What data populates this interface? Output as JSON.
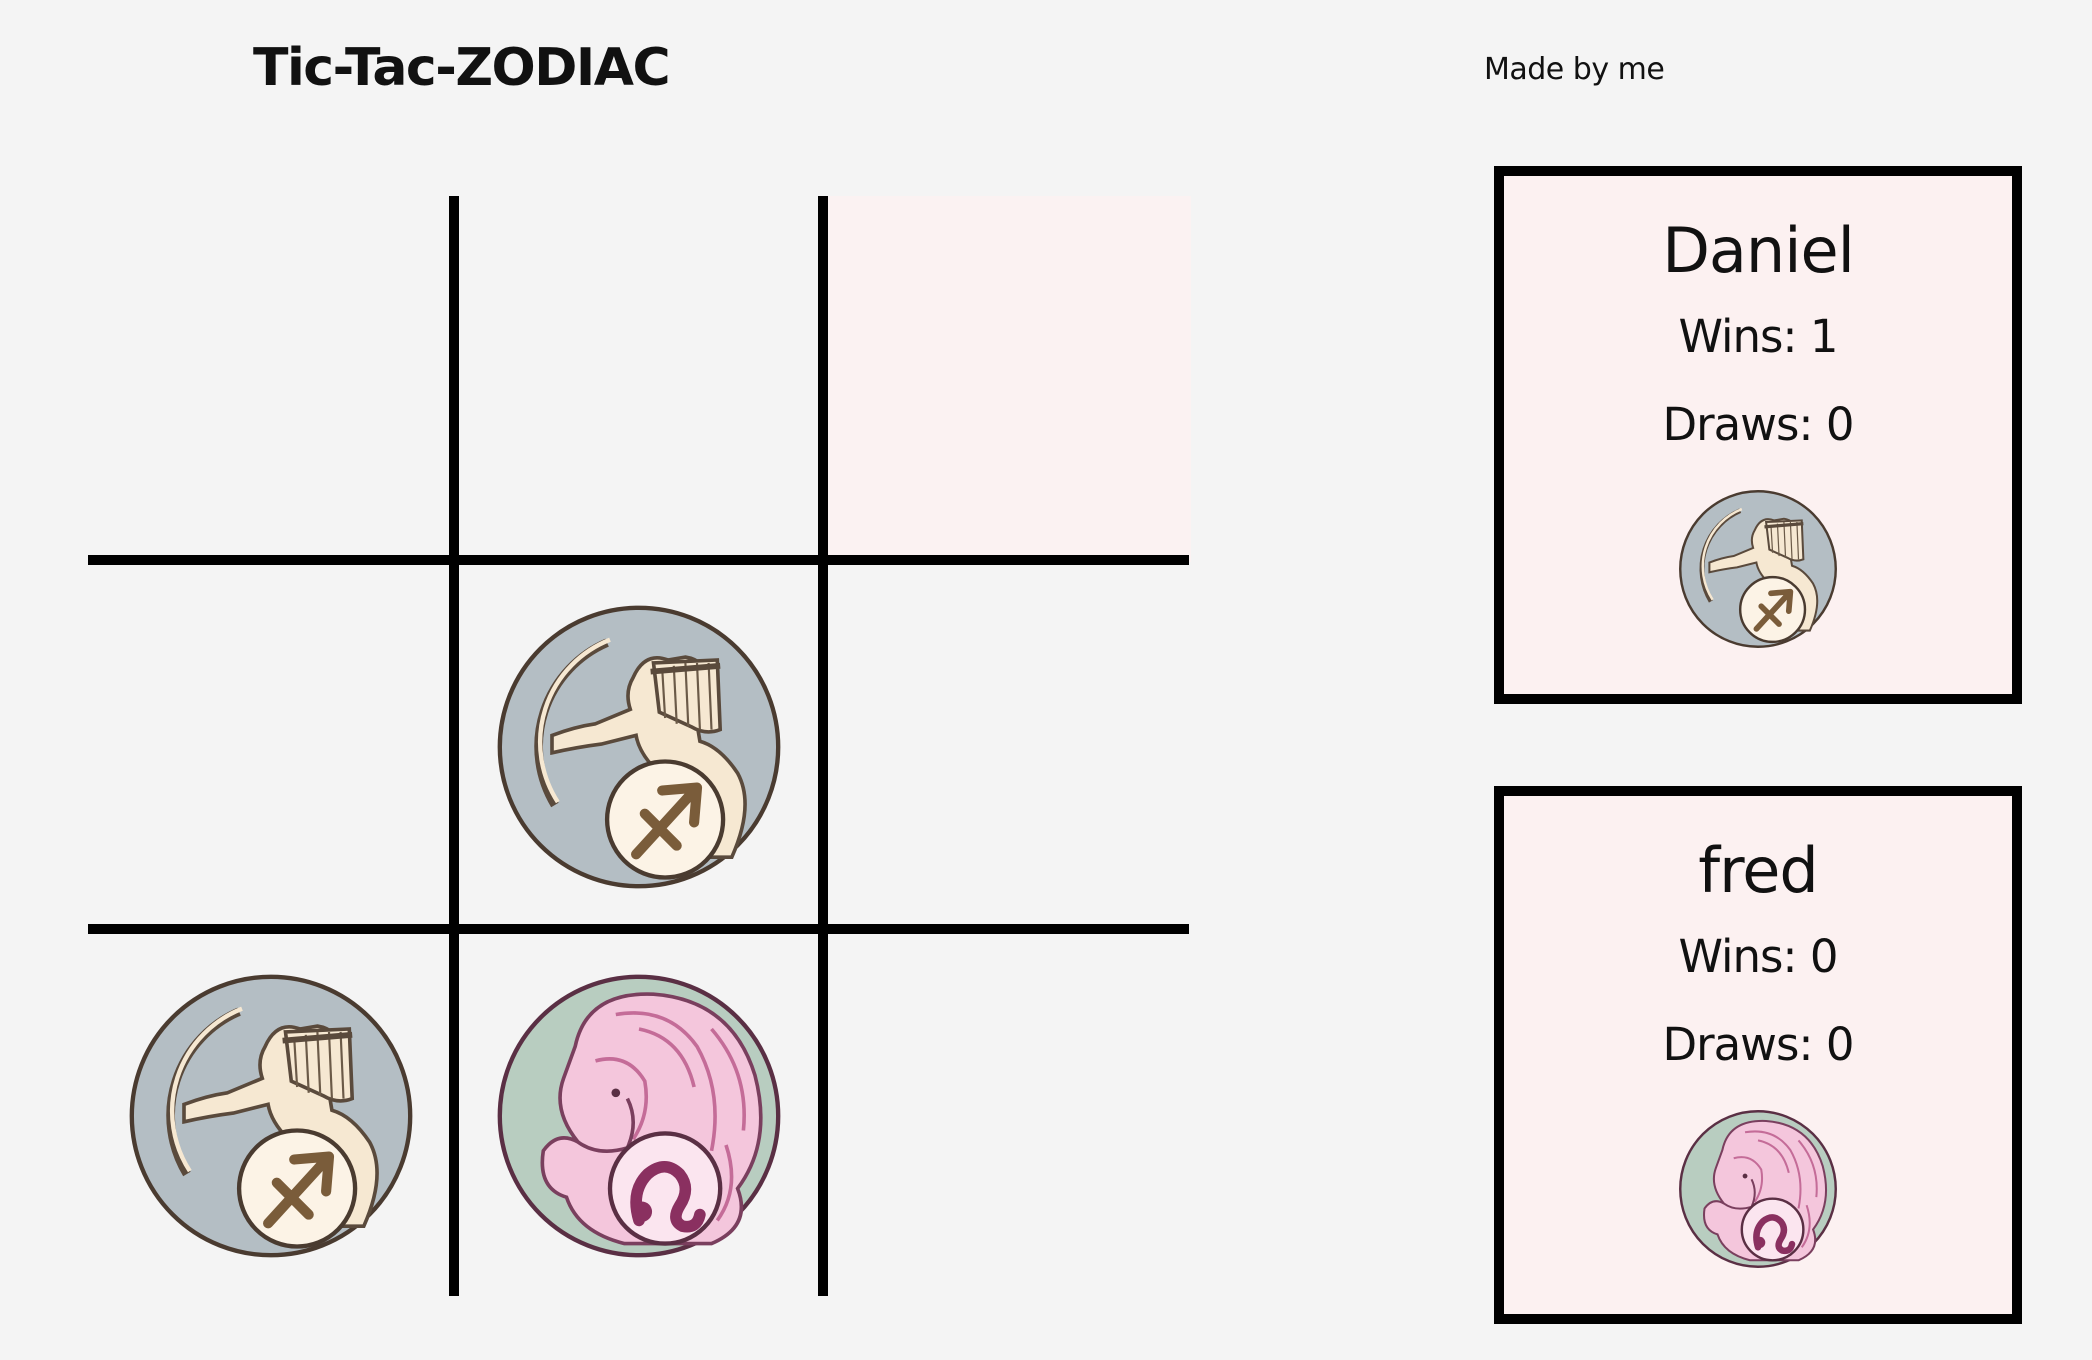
{
  "header": {
    "title": "Tic-Tac-ZODIAC",
    "credit": "Made by me"
  },
  "board": {
    "cells": [
      {
        "mark": ""
      },
      {
        "mark": ""
      },
      {
        "mark": "",
        "state": "hover"
      },
      {
        "mark": ""
      },
      {
        "mark": "sagittarius"
      },
      {
        "mark": ""
      },
      {
        "mark": "sagittarius"
      },
      {
        "mark": "leo"
      },
      {
        "mark": ""
      }
    ]
  },
  "players": [
    {
      "name": "Daniel",
      "wins": "Wins: 1",
      "draws": "Draws: 0",
      "sign": "sagittarius"
    },
    {
      "name": "fred",
      "wins": "Wins: 0",
      "draws": "Draws: 0",
      "sign": "leo"
    }
  ],
  "colors": {
    "background": "#f4f4f4",
    "card_background": "#fcf1f1",
    "hover_cell": "#fbf2f2",
    "sagittarius_bg": "#b4bec4",
    "sagittarius_figure": "#f6e8d2",
    "sagittarius_glyph": "#7a5c3a",
    "leo_bg": "#b8cdc0",
    "leo_figure": "#f4c6dc",
    "leo_glyph": "#8a3060"
  }
}
